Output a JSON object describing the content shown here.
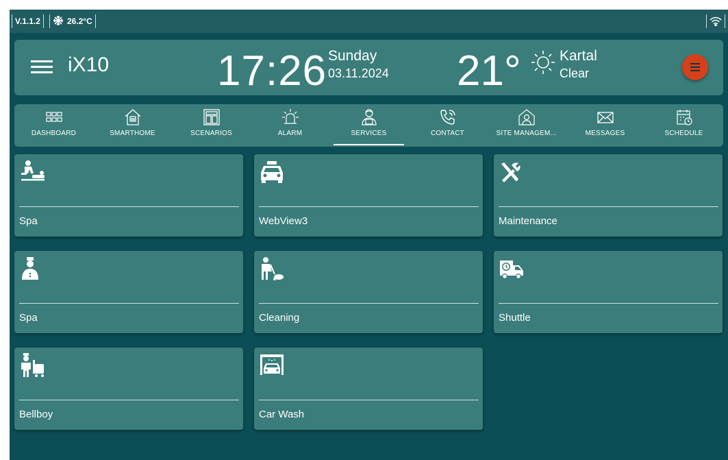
{
  "status_bar": {
    "version": "V.1.1.2",
    "indoor_temp": "26.2°C",
    "icons": [
      "snowflake-icon",
      "wifi-icon"
    ]
  },
  "header": {
    "app_name": "iX10",
    "time": "17:26",
    "day": "Sunday",
    "date": "03.11.2024",
    "temperature": "21°",
    "city": "Kartal",
    "condition": "Clear",
    "notification_color": "#d6401a"
  },
  "nav": {
    "active": "SERVICES",
    "items": [
      {
        "label": "DASHBOARD",
        "icon": "dashboard-grid-icon"
      },
      {
        "label": "SMARTHOME",
        "icon": "house-icon"
      },
      {
        "label": "SCENARIOS",
        "icon": "scenarios-icon"
      },
      {
        "label": "ALARM",
        "icon": "siren-icon"
      },
      {
        "label": "SERVICES",
        "icon": "services-person-icon"
      },
      {
        "label": "CONTACT",
        "icon": "phone-icon"
      },
      {
        "label": "SITE MANAGEM...",
        "icon": "site-management-icon"
      },
      {
        "label": "MESSAGES",
        "icon": "envelope-icon"
      },
      {
        "label": "SCHEDULE",
        "icon": "calendar-icon"
      }
    ]
  },
  "services": [
    {
      "label": "Spa",
      "icon": "massage-icon"
    },
    {
      "label": "WebView3",
      "icon": "taxi-icon"
    },
    {
      "label": "Maintenance",
      "icon": "tools-icon"
    },
    {
      "label": "Spa",
      "icon": "concierge-icon"
    },
    {
      "label": "Cleaning",
      "icon": "cleaning-icon"
    },
    {
      "label": "Shuttle",
      "icon": "shuttle-icon"
    },
    {
      "label": "Bellboy",
      "icon": "bellboy-icon"
    },
    {
      "label": "Car Wash",
      "icon": "car-wash-icon"
    }
  ],
  "colors": {
    "background": "#0c4e55",
    "panel": "#3a7d7a",
    "statusbar": "#215c63",
    "accent": "#d6401a"
  }
}
